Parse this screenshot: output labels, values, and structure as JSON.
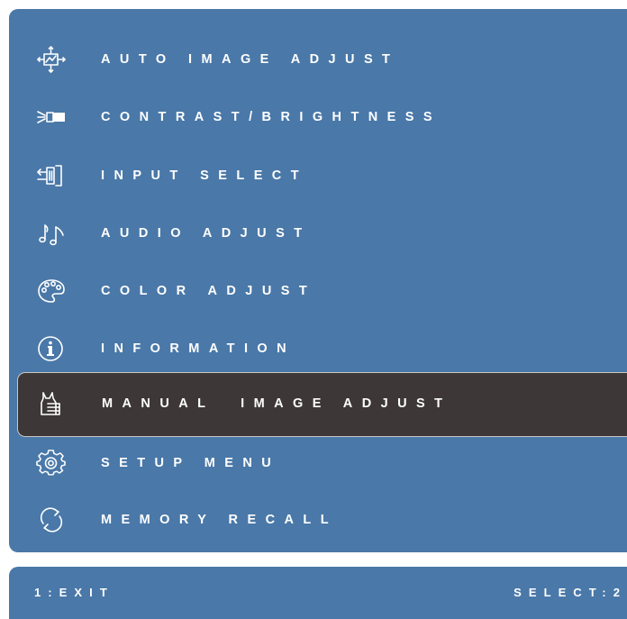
{
  "menu": {
    "items": [
      {
        "label": "AUTO IMAGE ADJUST",
        "icon": "auto-image-adjust-icon"
      },
      {
        "label": "CONTRAST/BRIGHTNESS",
        "icon": "contrast-brightness-icon"
      },
      {
        "label": "INPUT SELECT",
        "icon": "input-select-icon"
      },
      {
        "label": "AUDIO ADJUST",
        "icon": "audio-icon"
      },
      {
        "label": "COLOR ADJUST",
        "icon": "palette-icon"
      },
      {
        "label": "INFORMATION",
        "icon": "info-icon"
      },
      {
        "label": "MANUAL  IMAGE ADJUST",
        "icon": "manual-adjust-hand-icon",
        "selected": true
      },
      {
        "label": "SETUP MENU",
        "icon": "gear-icon"
      },
      {
        "label": "MEMORY RECALL",
        "icon": "refresh-icon"
      }
    ]
  },
  "status": {
    "exit_label": "1:EXIT",
    "select_label": "SELECT:2"
  },
  "colors": {
    "panel": "#4a78a8",
    "selected_bg": "#3d3837",
    "text": "#ffffff"
  }
}
